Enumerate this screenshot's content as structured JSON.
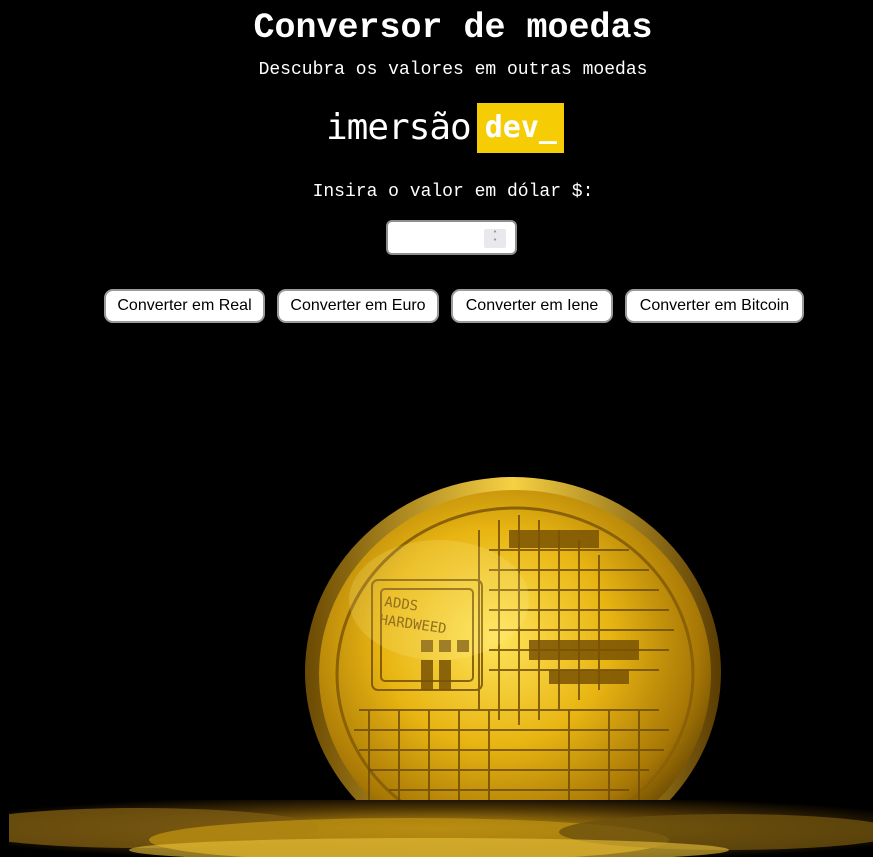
{
  "header": {
    "title": "Conversor de moedas",
    "subtitle": "Descubra os valores em outras moedas"
  },
  "logo": {
    "text": "imersão",
    "tag": "dev_",
    "tag_color": "#f6cd05"
  },
  "form": {
    "prompt": "Insira o valor em dólar $:",
    "input_value": "",
    "input_type": "number"
  },
  "buttons": {
    "real": "Converter em Real",
    "euro": "Converter em Euro",
    "iene": "Converter em Iene",
    "bitcoin": "Converter em Bitcoin"
  },
  "image": {
    "subject": "bitcoin-coin",
    "coin_text": "ADDS HARDWEED",
    "coin_color": "#d9a90e"
  },
  "colors": {
    "background": "#000000",
    "text": "#ffffff",
    "accent": "#f6cd05"
  }
}
